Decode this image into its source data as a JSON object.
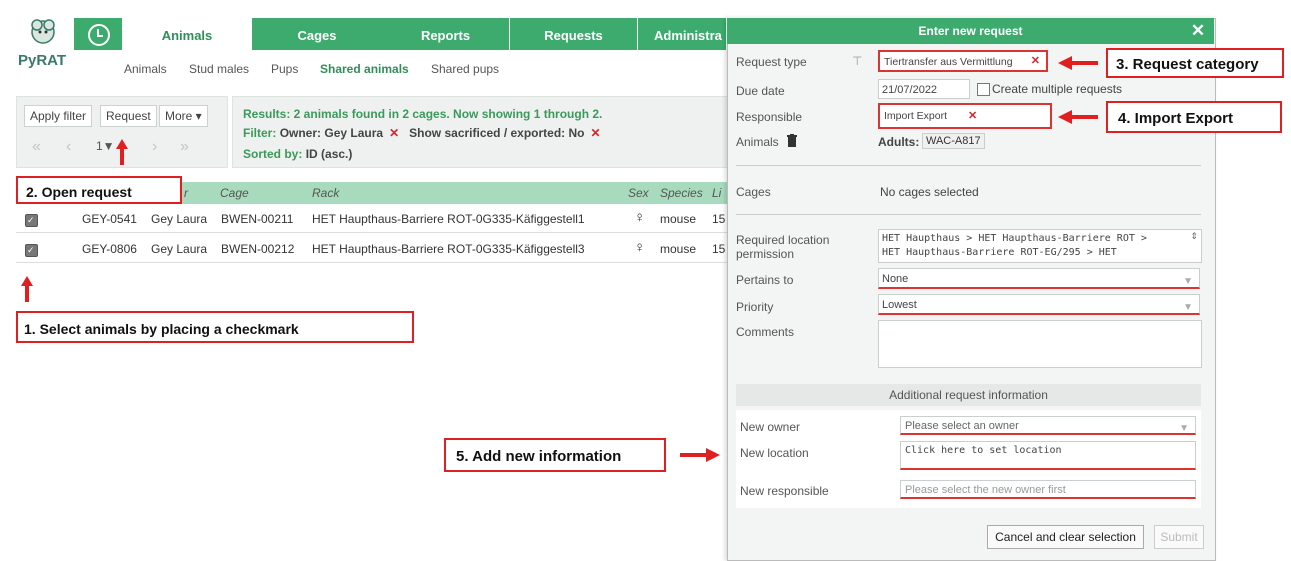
{
  "app": {
    "brand": "PyRAT"
  },
  "nav": {
    "tabs": [
      "Animals",
      "Cages",
      "Reports",
      "Requests",
      "Administra"
    ],
    "subtabs": [
      "Animals",
      "Stud males",
      "Pups",
      "Shared animals",
      "Shared pups"
    ]
  },
  "toolbar": {
    "apply_filter": "Apply filter",
    "request": "Request",
    "more": "More ▾",
    "pager": [
      "«",
      "‹",
      "1▼",
      "›",
      "»"
    ]
  },
  "results": {
    "summary": "Results: 2 animals found in 2 cages. Now showing 1 through 2.",
    "filter_label": "Filter:",
    "filter_owner": "Owner: Gey Laura",
    "filter_sacrificed": "Show sacrificed / exported: No",
    "sorted_label": "Sorted by:",
    "sorted_value": "ID (asc.)"
  },
  "table": {
    "headers": [
      "r",
      "Cage",
      "Rack",
      "Sex",
      "Species",
      "Li"
    ],
    "rows": [
      {
        "id": "GEY-0541",
        "owner": "Gey Laura",
        "cage": "BWEN-00211",
        "rack": "HET Haupthaus-Barriere ROT-0G335-Käfiggestell1",
        "sex": "♀",
        "species": "mouse",
        "li": "15"
      },
      {
        "id": "GEY-0806",
        "owner": "Gey Laura",
        "cage": "BWEN-00212",
        "rack": "HET Haupthaus-Barriere ROT-0G335-Käfiggestell3",
        "sex": "♀",
        "species": "mouse",
        "li": "15"
      }
    ]
  },
  "callouts": {
    "c1": "1. Select animals by placing a checkmark",
    "c2": "2. Open request",
    "c3": "3. Request category",
    "c4": "4. Import Export",
    "c5": "5. Add new information"
  },
  "dialog": {
    "title": "Enter new request",
    "close": "✕",
    "request_type_label": "Request type",
    "request_type_value": "Tiertransfer aus Vermittlung",
    "due_date_label": "Due date",
    "due_date_value": "21/07/2022",
    "create_multiple": "Create multiple requests",
    "responsible_label": "Responsible",
    "responsible_value": "Import Export",
    "animals_label": "Animals",
    "adults_label": "Adults:",
    "adults_value": "WAC-A817",
    "cages_label": "Cages",
    "cages_value": "No cages selected",
    "req_location_label_1": "Required location",
    "req_location_label_2": "permission",
    "req_location_line1": "HET Haupthaus > HET Haupthaus-Barriere ROT >",
    "req_location_line2": "HET Haupthaus-Barriere ROT-EG/295 > HET",
    "pertains_label": "Pertains to",
    "pertains_value": "None",
    "priority_label": "Priority",
    "priority_value": "Lowest",
    "comments_label": "Comments",
    "additional_header": "Additional request information",
    "new_owner_label": "New owner",
    "new_owner_placeholder": "Please select an owner",
    "new_location_label": "New location",
    "new_location_placeholder": "Click here to set location",
    "new_responsible_label": "New responsible",
    "new_responsible_placeholder": "Please select the new owner first",
    "cancel_btn": "Cancel and clear selection",
    "submit_btn": "Submit"
  },
  "colors": {
    "accent": "#3cab6d",
    "callout": "#e02020"
  }
}
